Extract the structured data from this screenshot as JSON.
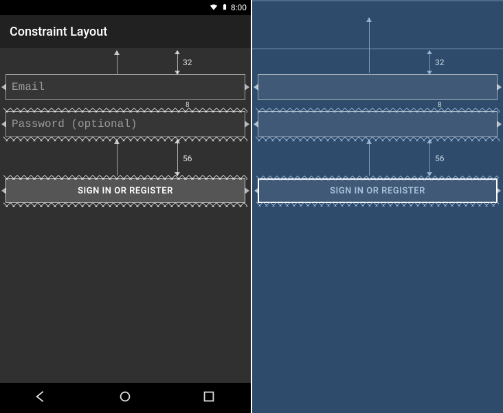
{
  "status": {
    "time": "8:00"
  },
  "title": "Constraint Layout",
  "constraints": {
    "email_top_margin": "32",
    "password_top_margin": "8",
    "button_top_margin": "56"
  },
  "fields": {
    "email_placeholder": "Email",
    "password_placeholder": "Password (optional)"
  },
  "button": {
    "label": "SIGN IN OR REGISTER"
  }
}
